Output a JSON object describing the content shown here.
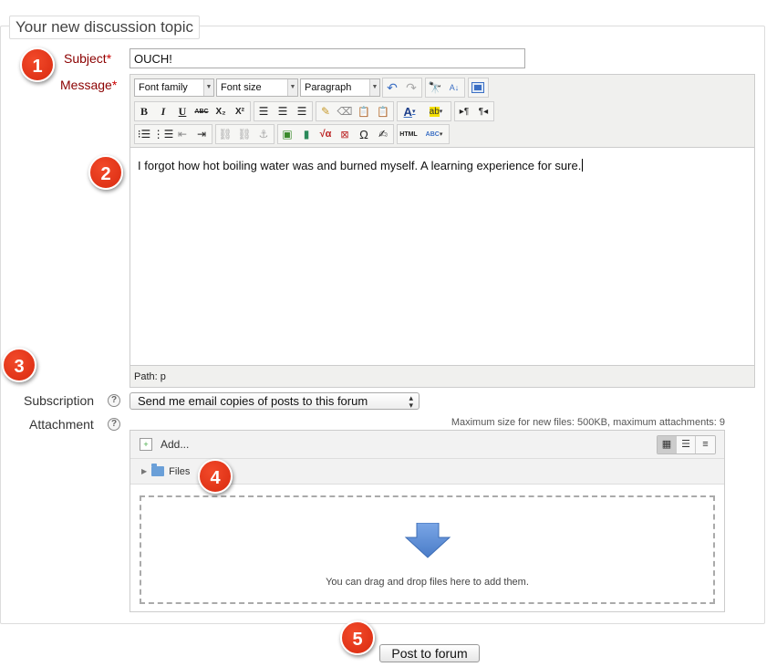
{
  "legend": "Your new discussion topic",
  "labels": {
    "subject": "Subject",
    "message": "Message",
    "required_mark": "*",
    "subscription": "Subscription",
    "attachment": "Attachment",
    "help": "?"
  },
  "subject": {
    "value": "OUCH!"
  },
  "editor": {
    "font_family": "Font family",
    "font_size": "Font size",
    "format": "Paragraph",
    "content": "I forgot how hot boiling water was and burned myself.  A learning experience for sure.",
    "status_path": "Path: p",
    "buttons": {
      "bold": "B",
      "italic": "I",
      "underline": "U",
      "strike": "ABC",
      "subscript": "X₂",
      "superscript": "X²",
      "html": "HTML",
      "omega": "Ω",
      "spell": "ABC"
    }
  },
  "subscription": {
    "selected": "Send me email copies of posts to this forum"
  },
  "attachments": {
    "max_note": "Maximum size for new files: 500KB, maximum attachments: 9",
    "add_label": "Add...",
    "folder_label": "Files",
    "drop_text": "You can drag and drop files here to add them."
  },
  "submit_label": "Post to forum",
  "badges": [
    "1",
    "2",
    "3",
    "4",
    "5"
  ],
  "colors": {
    "required": "#8b0000",
    "badge": "#e03a1c",
    "drop_arrow": "#5b8ed6"
  }
}
